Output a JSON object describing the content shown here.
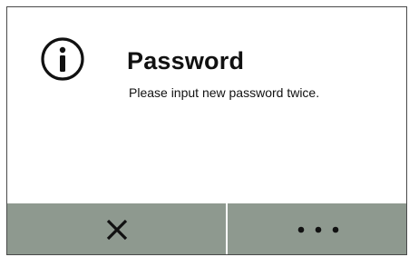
{
  "dialog": {
    "title": "Password",
    "message": "Please input new password twice.",
    "icon": "info-icon"
  },
  "buttons": {
    "close_icon": "close-icon",
    "more_icon": "more-dots-icon"
  },
  "colors": {
    "button_background": "#8e998f",
    "text": "#111111",
    "border": "#4a4a4a"
  }
}
